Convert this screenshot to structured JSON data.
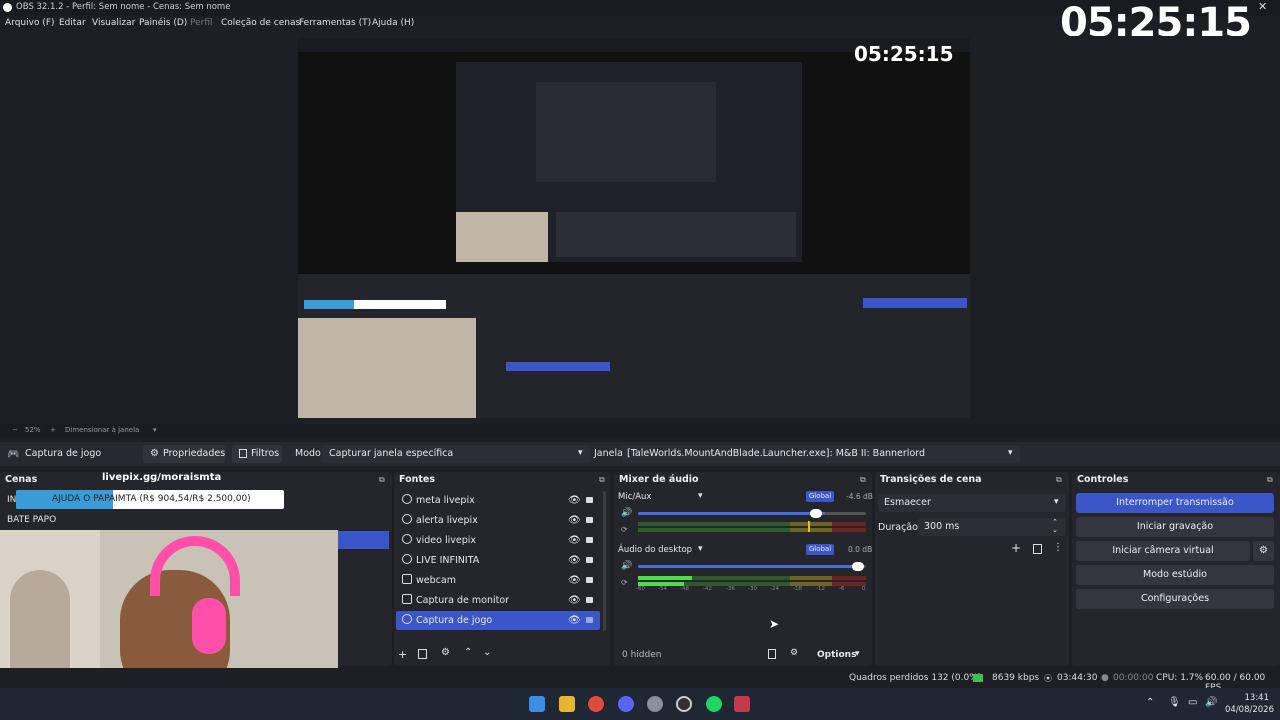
{
  "window": {
    "title": "OBS 32.1.2 - Perfil: Sem nome - Cenas: Sem nome"
  },
  "menu": [
    "Arquivo (F)",
    "Editar",
    "Visualizar",
    "Painéis (D)",
    "Perfil",
    "Coleção de cenas",
    "Ferramentas (T)",
    "Ajuda (H)"
  ],
  "overlay": {
    "clock": "05:25:15",
    "livepix_url": "livepix.gg/moraismta",
    "banner_text": "AJUDA O PAPAIMTA (R$ 904,54/R$ 2.500,00)",
    "bate_papo": "BATE PAPO",
    "goal_progress": 0.362
  },
  "preview": {
    "zoom": "52%",
    "resize_label": "Dimensionar à janela"
  },
  "source_toolbar": {
    "source_name": "Captura de jogo",
    "properties": "Propriedades",
    "filters": "Filtros",
    "mode_label": "Modo",
    "mode_value": "Capturar janela específica",
    "window_label": "Janela",
    "window_value": "[TaleWorlds.MountAndBlade.Launcher.exe]: M&B II: Bannerlord"
  },
  "docks": {
    "scenes": "Cenas",
    "sources": "Fontes",
    "mixer": "Mixer de áudio",
    "transitions": "Transições de cena",
    "controls": "Controles"
  },
  "sources": [
    {
      "name": "meta livepix",
      "icon": "gamepad-icon"
    },
    {
      "name": "alerta livepix",
      "icon": "gamepad-icon"
    },
    {
      "name": "video livepix",
      "icon": "gamepad-icon"
    },
    {
      "name": "LIVE INFINITA",
      "icon": "gamepad-icon"
    },
    {
      "name": "webcam",
      "icon": "camera-icon"
    },
    {
      "name": "Captura de monitor",
      "icon": "monitor-icon"
    },
    {
      "name": "Captura de jogo",
      "icon": "gamepad-icon"
    }
  ],
  "mixer": {
    "channels": [
      {
        "name": "Mic/Aux",
        "badge": "Global",
        "db": "-4.6 dB",
        "volume": 0.82
      },
      {
        "name": "Áudio do desktop",
        "badge": "Global",
        "db": "0.0 dB",
        "volume": 0.98
      }
    ],
    "scale": [
      "-60",
      "-54",
      "-48",
      "-42",
      "-36",
      "-30",
      "-24",
      "-18",
      "-12",
      "-6",
      "0"
    ],
    "hidden": "0 hidden",
    "options": "Options"
  },
  "transitions": {
    "type": "Esmaecer",
    "duration_label": "Duração",
    "duration_value": "300 ms"
  },
  "controls": [
    "Interromper transmissão",
    "Iniciar gravação",
    "Iniciar câmera virtual",
    "Modo estúdio",
    "Configurações"
  ],
  "status": {
    "dropped": "Quadros perdidos 132 (0.0%)",
    "bitrate": "8639 kbps",
    "stream_time": "03:44:30",
    "rec_time": "00:00:00",
    "cpu": "CPU: 1.7%",
    "fps": "60.00 / 60.00 FPS"
  },
  "taskbar": {
    "time": "13:41",
    "date": "04/08/2026"
  },
  "colors": {
    "accent": "#3a56c9",
    "panel": "#25262c",
    "bg": "#1e1f24"
  }
}
